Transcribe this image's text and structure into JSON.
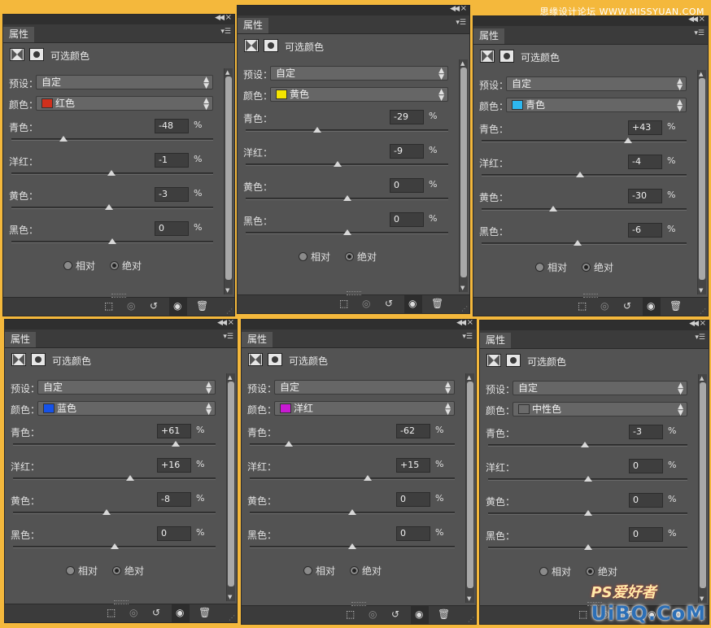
{
  "watermarks": {
    "top": "思缘设计论坛 WWW.MISSYUAN.COM",
    "bottom_ps": "PS爱好者",
    "bottom_site": "UiBQ.CoM"
  },
  "common": {
    "tab_label": "属性",
    "panel_title": "可选颜色",
    "preset_label": "预设：",
    "preset_value": "自定",
    "color_label": "颜色：",
    "radio_relative": "相对",
    "radio_absolute": "绝对",
    "selected_method": "absolute",
    "pct": "%",
    "slider_labels": {
      "cyan": "青色：",
      "magenta": "洋红：",
      "yellow": "黄色：",
      "black": "黑色："
    }
  },
  "panels": [
    {
      "color_name": "红色",
      "swatch": "#d0301c",
      "values": {
        "cyan": "-48",
        "magenta": "-1",
        "yellow": "-3",
        "black": "0"
      },
      "levels": {
        "cyan": -48,
        "magenta": -1,
        "yellow": -3,
        "black": 0
      }
    },
    {
      "color_name": "黄色",
      "swatch": "#f5e400",
      "values": {
        "cyan": "-29",
        "magenta": "-9",
        "yellow": "0",
        "black": "0"
      },
      "levels": {
        "cyan": -29,
        "magenta": -9,
        "yellow": 0,
        "black": 0
      }
    },
    {
      "color_name": "青色",
      "swatch": "#2db8f0",
      "values": {
        "cyan": "+43",
        "magenta": "-4",
        "yellow": "-30",
        "black": "-6"
      },
      "levels": {
        "cyan": 43,
        "magenta": -4,
        "yellow": -30,
        "black": -6
      }
    },
    {
      "color_name": "蓝色",
      "swatch": "#1652e8",
      "values": {
        "cyan": "+61",
        "magenta": "+16",
        "yellow": "-8",
        "black": "0"
      },
      "levels": {
        "cyan": 61,
        "magenta": 16,
        "yellow": -8,
        "black": 0
      }
    },
    {
      "color_name": "洋红",
      "swatch": "#c81ad2",
      "values": {
        "cyan": "-62",
        "magenta": "+15",
        "yellow": "0",
        "black": "0"
      },
      "levels": {
        "cyan": -62,
        "magenta": 15,
        "yellow": 0,
        "black": 0
      }
    },
    {
      "color_name": "中性色",
      "swatch": "#6b6b6b",
      "values": {
        "cyan": "-3",
        "magenta": "0",
        "yellow": "0",
        "black": "0"
      },
      "levels": {
        "cyan": -3,
        "magenta": 0,
        "yellow": 0,
        "black": 0
      }
    }
  ]
}
